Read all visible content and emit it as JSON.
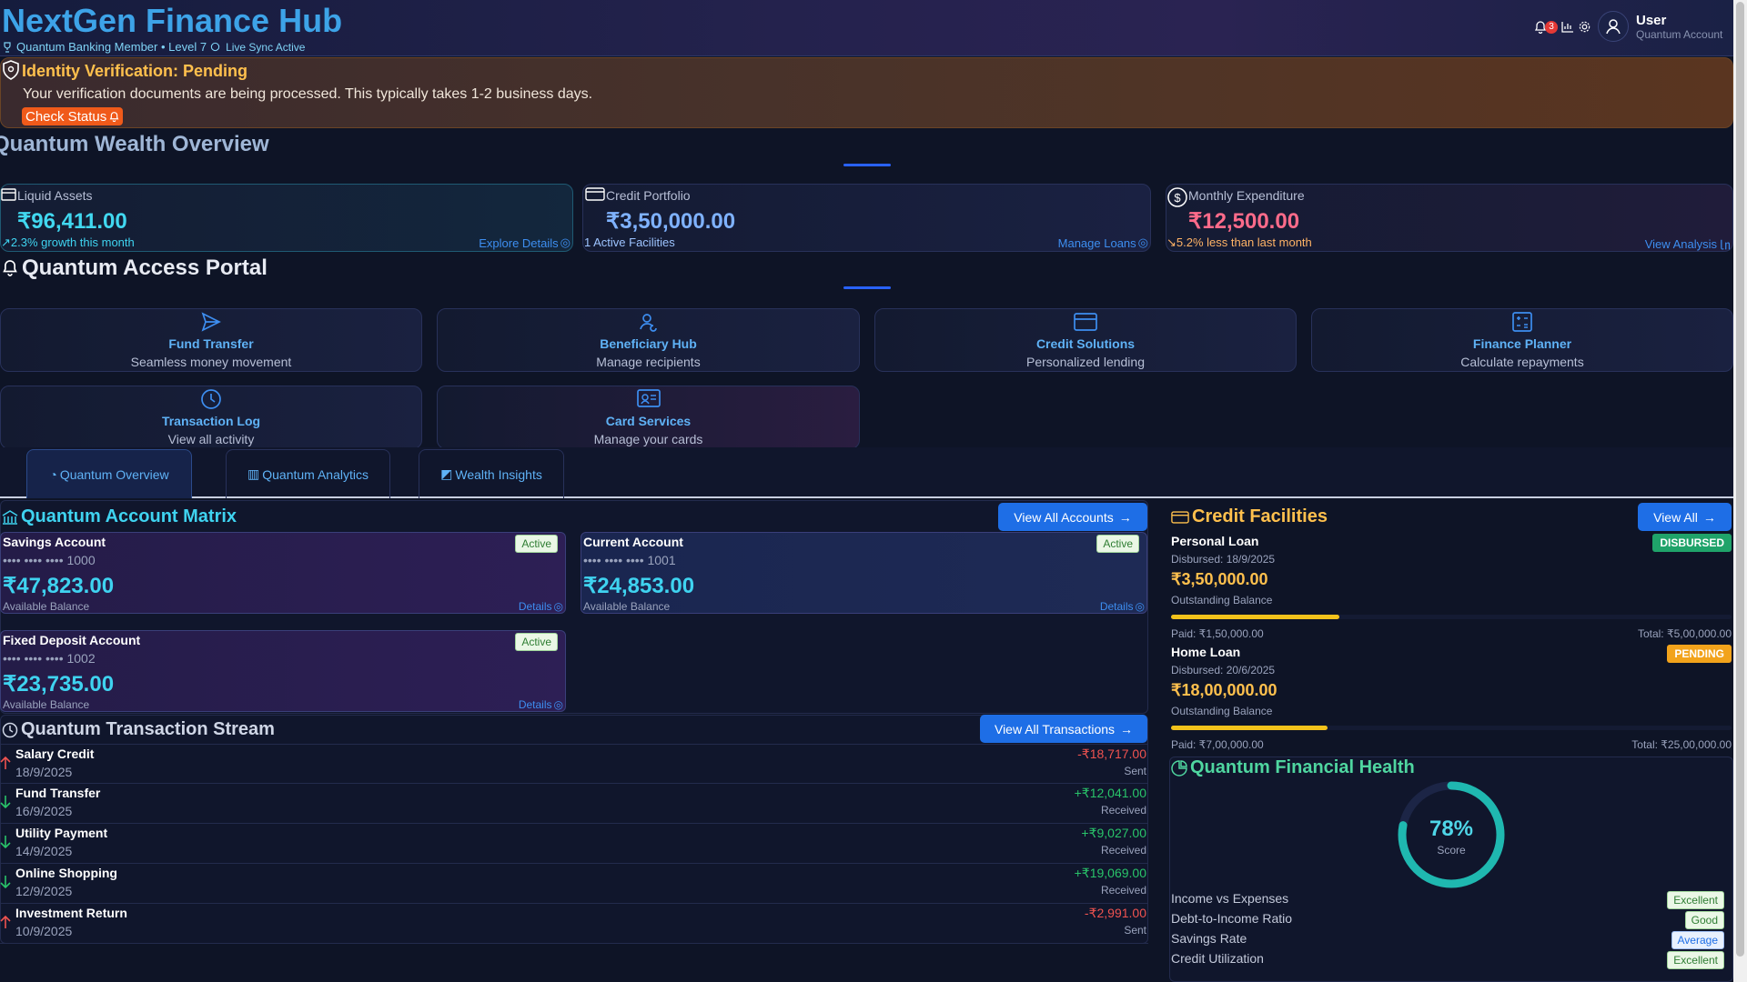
{
  "header": {
    "brand": "NextGen Finance Hub",
    "member": "Quantum Banking Member • Level 7",
    "sync": "Live Sync Active",
    "notification_count": "3",
    "user_name": "User",
    "user_sub": "Quantum Account"
  },
  "alert": {
    "title": "Identity Verification: Pending",
    "message": "Your verification documents are being processed. This typically takes 1-2 business days.",
    "button": "Check Status"
  },
  "overview": {
    "title": "Quantum Wealth Overview",
    "cards": [
      {
        "label": "Liquid Assets",
        "value": "₹96,411.00",
        "sub": "2.3% growth this month",
        "link": "Explore Details",
        "value_color": "#41d8f0",
        "sub_color": "#3fd3f0"
      },
      {
        "label": "Credit Portfolio",
        "value": "₹3,50,000.00",
        "sub": "1 Active Facilities",
        "link": "Manage Loans",
        "value_color": "#7fb2ff",
        "sub_color": "#9dc4ff"
      },
      {
        "label": "Monthly Expenditure",
        "value": "₹12,500.00",
        "sub": "5.2% less than last month",
        "link": "View Analysis",
        "value_color": "#ff6b8a",
        "sub_color": "#ffb366"
      }
    ]
  },
  "portal": {
    "title": "Quantum Access Portal",
    "items": [
      {
        "title": "Fund Transfer",
        "sub": "Seamless money movement",
        "icon": "send-icon"
      },
      {
        "title": "Beneficiary Hub",
        "sub": "Manage recipients",
        "icon": "users-icon"
      },
      {
        "title": "Credit Solutions",
        "sub": "Personalized lending",
        "icon": "credit-card-icon"
      },
      {
        "title": "Finance Planner",
        "sub": "Calculate repayments",
        "icon": "calculator-icon"
      },
      {
        "title": "Transaction Log",
        "sub": "View all activity",
        "icon": "clock-icon"
      },
      {
        "title": "Card Services",
        "sub": "Manage your cards",
        "icon": "id-card-icon"
      }
    ]
  },
  "tabs": [
    "Quantum Overview",
    "Quantum Analytics",
    "Wealth Insights"
  ],
  "accounts": {
    "title": "Quantum Account Matrix",
    "button": "View All Accounts",
    "items": [
      {
        "name": "Savings Account",
        "number": "•••• •••• •••• 1000",
        "balance": "₹47,823.00",
        "balance_label": "Available Balance",
        "status": "Active",
        "details": "Details"
      },
      {
        "name": "Current Account",
        "number": "•••• •••• •••• 1001",
        "balance": "₹24,853.00",
        "balance_label": "Available Balance",
        "status": "Active",
        "details": "Details"
      },
      {
        "name": "Fixed Deposit Account",
        "number": "•••• •••• •••• 1002",
        "balance": "₹23,735.00",
        "balance_label": "Available Balance",
        "status": "Active",
        "details": "Details"
      }
    ]
  },
  "transactions": {
    "title": "Quantum Transaction Stream",
    "button": "View All Transactions",
    "items": [
      {
        "name": "Salary Credit",
        "date": "18/9/2025",
        "amount": "-₹18,717.00",
        "kind": "Sent",
        "direction": "up"
      },
      {
        "name": "Fund Transfer",
        "date": "16/9/2025",
        "amount": "+₹12,041.00",
        "kind": "Received",
        "direction": "down"
      },
      {
        "name": "Utility Payment",
        "date": "14/9/2025",
        "amount": "+₹9,027.00",
        "kind": "Received",
        "direction": "down"
      },
      {
        "name": "Online Shopping",
        "date": "12/9/2025",
        "amount": "+₹19,069.00",
        "kind": "Received",
        "direction": "down"
      },
      {
        "name": "Investment Return",
        "date": "10/9/2025",
        "amount": "-₹2,991.00",
        "kind": "Sent",
        "direction": "up"
      }
    ]
  },
  "credit": {
    "title": "Credit Facilities",
    "button": "View All",
    "loans": [
      {
        "name": "Personal Loan",
        "disbursed": "Disbursed: 18/9/2025",
        "balance": "₹3,50,000.00",
        "balance_label": "Outstanding Balance",
        "status": "DISBURSED",
        "status_color": "#1fa36a",
        "paid": "Paid: ₹1,50,000.00",
        "total": "Total: ₹5,00,000.00",
        "progress": 0.3
      },
      {
        "name": "Home Loan",
        "disbursed": "Disbursed: 20/6/2025",
        "balance": "₹18,00,000.00",
        "balance_label": "Outstanding Balance",
        "status": "PENDING",
        "status_color": "#f2a31b",
        "paid": "Paid: ₹7,00,000.00",
        "total": "Total: ₹25,00,000.00",
        "progress": 0.28
      }
    ]
  },
  "health": {
    "title": "Quantum Financial Health",
    "score": "78%",
    "score_label": "Score",
    "score_value": 0.78,
    "rows": [
      {
        "label": "Income vs Expenses",
        "rating": "Excellent",
        "tone": "green"
      },
      {
        "label": "Debt-to-Income Ratio",
        "rating": "Good",
        "tone": "green"
      },
      {
        "label": "Savings Rate",
        "rating": "Average",
        "tone": "blue"
      },
      {
        "label": "Credit Utilization",
        "rating": "Excellent",
        "tone": "green"
      }
    ]
  }
}
